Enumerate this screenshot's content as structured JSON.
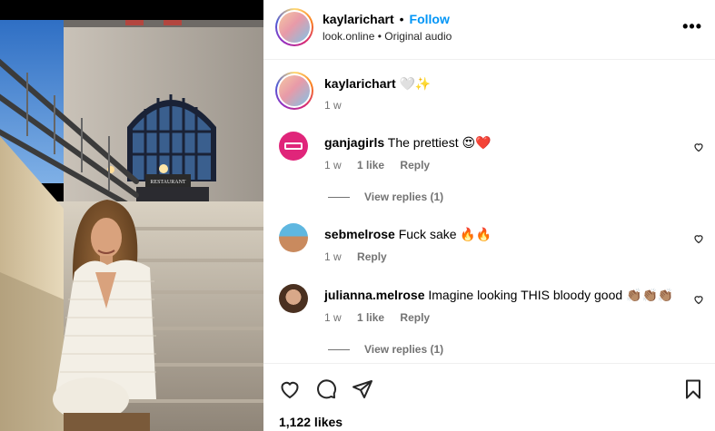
{
  "header": {
    "username": "kaylarichart",
    "separator": "•",
    "follow_label": "Follow",
    "subline": "look.online • Original audio",
    "more_label": "•••"
  },
  "caption": {
    "username": "kaylarichart",
    "text": "🤍✨",
    "time": "1 w"
  },
  "comments": [
    {
      "username": "ganjagirls",
      "text": "The prettiest 😍❤️",
      "time": "1 w",
      "likes": "1 like",
      "reply_label": "Reply",
      "view_replies": "View replies (1)"
    },
    {
      "username": "sebmelrose",
      "text": "Fuck sake 🔥🔥",
      "time": "1 w",
      "reply_label": "Reply"
    },
    {
      "username": "julianna.melrose",
      "text": "Imagine looking THIS bloody good 👏🏽👏🏽👏🏽",
      "time": "1 w",
      "likes": "1 like",
      "reply_label": "Reply",
      "view_replies": "View replies (1)"
    }
  ],
  "actions": {
    "likes": "1,122 likes",
    "icons": [
      "heart-icon",
      "comment-icon",
      "share-icon",
      "bookmark-icon"
    ]
  },
  "media": {
    "sign_text": "RESTAURANT"
  },
  "colors": {
    "follow": "#0095f6",
    "secondary_text": "#737373",
    "divider": "#efefef"
  }
}
